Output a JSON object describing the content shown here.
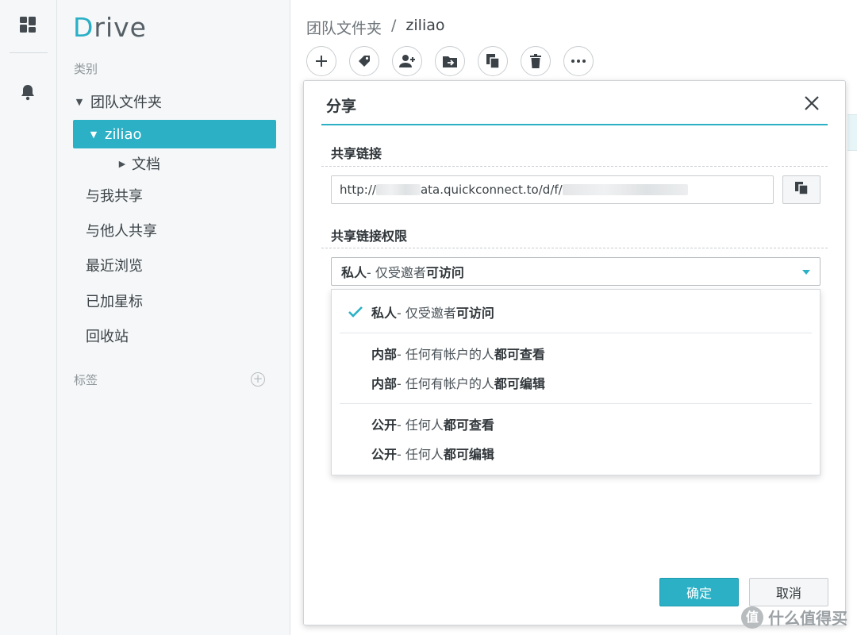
{
  "rail": {
    "icons": [
      "dashboard-grid-icon",
      "notification-bell-icon"
    ]
  },
  "nav": {
    "logo": {
      "first_letter": "D",
      "rest": "rive"
    },
    "category_caption": "类别",
    "tree": [
      {
        "label": "团队文件夹",
        "level": 0,
        "expanded": true
      },
      {
        "label": "ziliao",
        "level": 1,
        "expanded": true,
        "active": true
      },
      {
        "label": "文档",
        "level": 2,
        "expanded": false
      }
    ],
    "items": [
      "与我共享",
      "与他人共享",
      "最近浏览",
      "已加星标",
      "回收站"
    ],
    "tags_caption": "标签",
    "tag_add_glyph": "+"
  },
  "main": {
    "breadcrumb": {
      "root": "团队文件夹",
      "separator": "/",
      "current": "ziliao"
    },
    "toolbar": [
      "add-icon",
      "tag-icon",
      "add-user-icon",
      "move-to-icon",
      "copy-icon",
      "delete-icon",
      "more-icon"
    ]
  },
  "dialog": {
    "title": "分享",
    "share_link_label": "共享链接",
    "link": {
      "prefix": "http://",
      "visible_part": "ata.quickconnect.to/d/f/"
    },
    "permission_label": "共享链接权限",
    "selected": {
      "bold": "私人",
      "mid": " - 仅受邀者",
      "bold_end": "可访问"
    },
    "options": [
      {
        "bold": "私人",
        "mid": " - 仅受邀者",
        "bold_end": "可访问",
        "checked": true
      },
      {
        "bold": "内部",
        "mid": " - 任何有帐户的人",
        "bold_end": "都可查看",
        "checked": false
      },
      {
        "bold": "内部",
        "mid": " - 任何有帐户的人",
        "bold_end": "都可编辑",
        "checked": false
      },
      {
        "bold": "公开",
        "mid": " - 任何人",
        "bold_end": "都可查看",
        "checked": false
      },
      {
        "bold": "公开",
        "mid": " - 任何人",
        "bold_end": "都可编辑",
        "checked": false
      }
    ],
    "ok_label": "确定",
    "cancel_label": "取消"
  },
  "watermark": {
    "logo": "值",
    "text": "什么值得买"
  },
  "colors": {
    "accent": "#2bb0c5",
    "rail_bg": "#f5f7f8"
  }
}
